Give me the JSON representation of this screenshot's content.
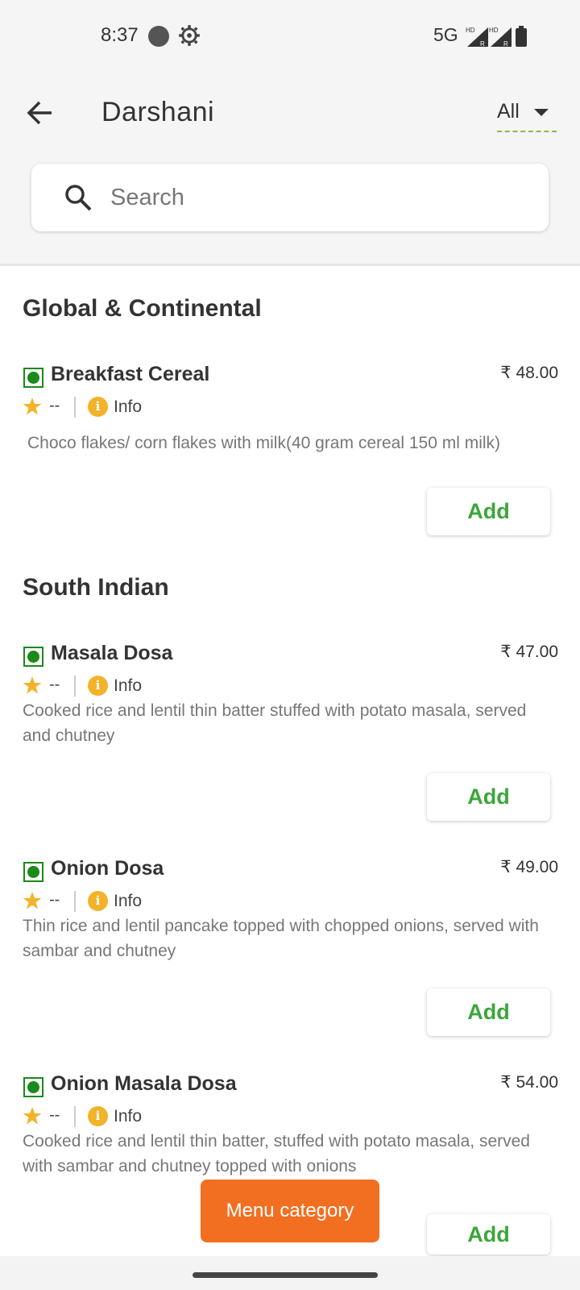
{
  "status_bar": {
    "time": "8:37",
    "network": "5G",
    "hd_label": "HD",
    "r_label": "R",
    "icons": [
      "circle-dot-icon",
      "gear-icon",
      "signal-icon",
      "signal-icon",
      "battery-icon"
    ]
  },
  "header": {
    "title": "Darshani",
    "filter_label": "All"
  },
  "search": {
    "placeholder": "Search"
  },
  "sections": [
    {
      "title": "Global & Continental",
      "items": [
        {
          "name": "Breakfast Cereal",
          "price": "₹ 48.00",
          "rating": "--",
          "info_label": "Info",
          "description": "Choco flakes/ corn flakes with milk(40 gram cereal 150 ml milk)",
          "add_label": "Add"
        }
      ]
    },
    {
      "title": "South Indian",
      "items": [
        {
          "name": "Masala Dosa",
          "price": "₹ 47.00",
          "rating": "--",
          "info_label": "Info",
          "description": "Cooked rice and lentil thin batter stuffed with potato masala, served and chutney",
          "add_label": "Add"
        },
        {
          "name": "Onion Dosa",
          "price": "₹ 49.00",
          "rating": "--",
          "info_label": "Info",
          "description": "Thin rice and lentil pancake topped with chopped onions, served with sambar and chutney",
          "add_label": "Add"
        },
        {
          "name": "Onion Masala Dosa",
          "price": "₹ 54.00",
          "rating": "--",
          "info_label": "Info",
          "description": "Cooked rice and lentil thin batter, stuffed with potato masala, served with sambar and chutney topped with onions",
          "add_label": "Add"
        }
      ]
    }
  ],
  "floating_button": {
    "label": "Menu category"
  },
  "colors": {
    "accent_green": "#3aa63a",
    "veg_green": "#1a8a1a",
    "orange": "#f26f21",
    "info_yellow": "#f2b32a"
  }
}
